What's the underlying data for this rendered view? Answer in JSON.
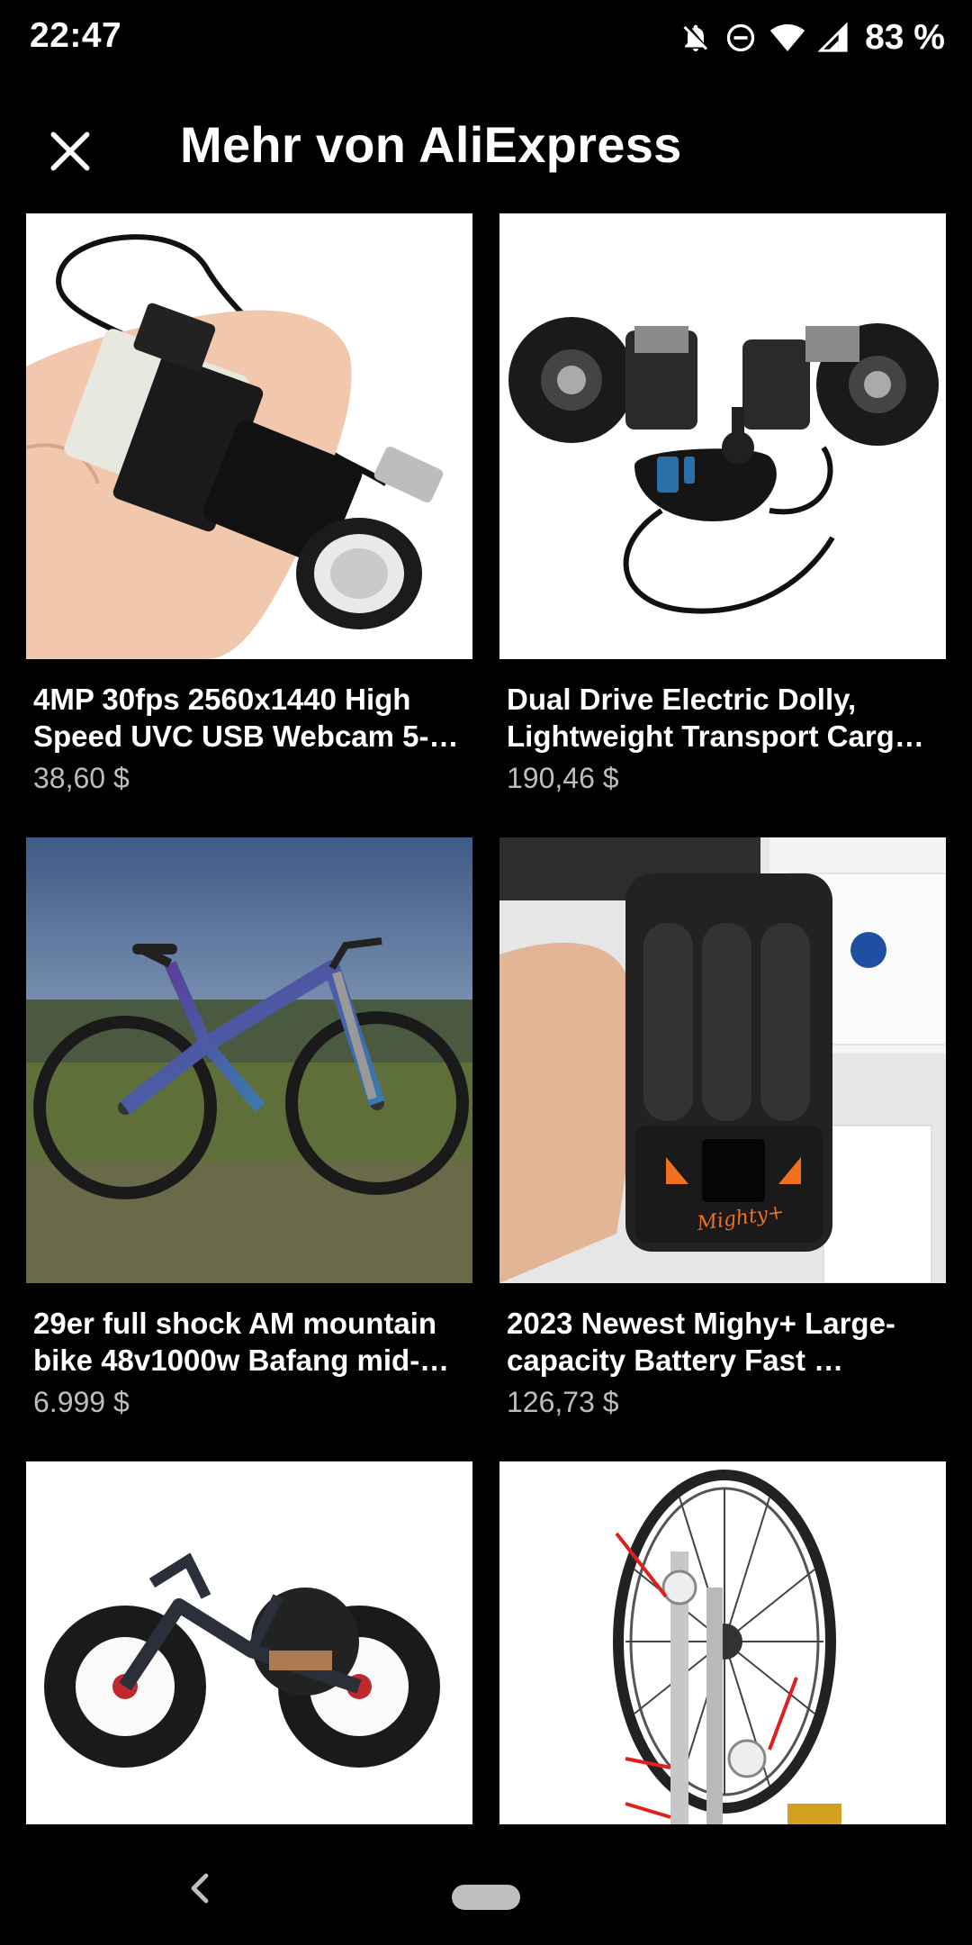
{
  "status_bar": {
    "time": "22:47",
    "battery": "83 %",
    "icons": [
      "notifications-off-icon",
      "do-not-disturb-icon",
      "wifi-icon",
      "cellular-signal-icon"
    ]
  },
  "header": {
    "close_icon": "close-icon",
    "title": "Mehr von AliExpress"
  },
  "products": [
    {
      "title": "4MP 30fps 2560x1440 High Speed UVC USB Webcam 5-…",
      "price": "38,60 $"
    },
    {
      "title": "Dual Drive Electric Dolly, Lightweight Transport Carg…",
      "price": "190,46 $"
    },
    {
      "title": "29er full shock AM mountain bike 48v1000w Bafang mid-…",
      "price": "6.999 $"
    },
    {
      "title": "2023 Newest Mighy+ Large-capacity Battery Fast …",
      "price": "126,73 $"
    },
    {
      "title": "",
      "price": ""
    },
    {
      "title": "",
      "price": ""
    }
  ],
  "nav_bar": {
    "back_icon": "back-chevron-icon",
    "home_icon": "home-pill-icon"
  }
}
